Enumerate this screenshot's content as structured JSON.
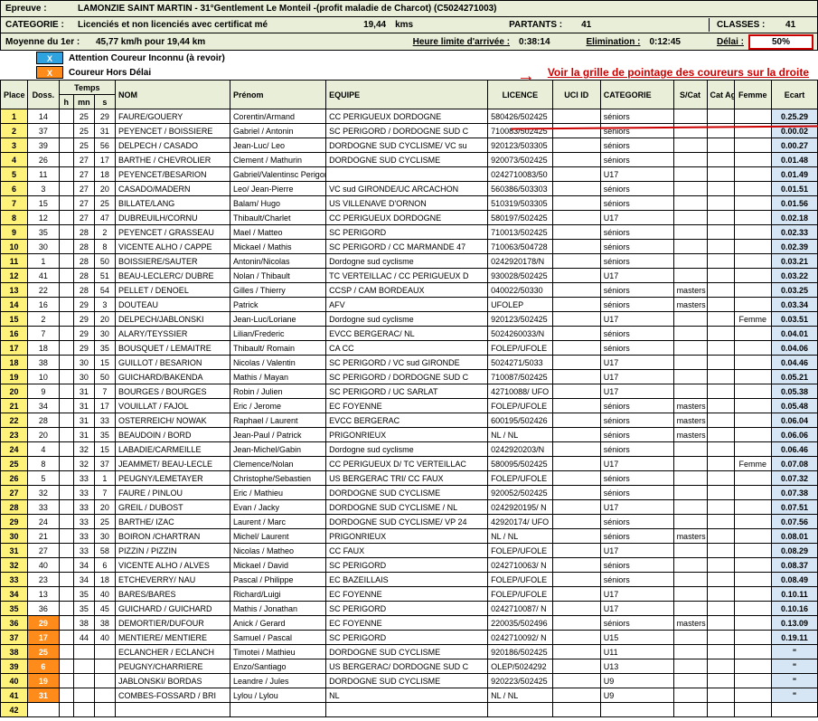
{
  "header": {
    "epreuve_label": "Epreuve :",
    "epreuve_value": "LAMONZIE SAINT MARTIN - 31°Gentlement Le Monteil -(profit maladie de Charcot) (C5024271003)",
    "categorie_label": "CATEGORIE :",
    "categorie_value": "Licenciés et non licenciés avec certificat mé",
    "dist_value": "19,44",
    "dist_unit": "kms",
    "partants_label": "PARTANTS :",
    "partants_value": "41",
    "classes_label": "CLASSES :",
    "classes_value": "41",
    "moyenne_label": "Moyenne du 1er :",
    "moyenne_value": "45,77  km/h   pour 19,44 km",
    "heure_label": "Heure limite d'arrivée :",
    "heure_value": "0:38:14",
    "elim_label": "Elimination :",
    "elim_value": "0:12:45",
    "delai_label": "Délai :",
    "delai_value": "50%"
  },
  "legend": {
    "x": "X",
    "unknown": "Attention Coureur Inconnu (à revoir)",
    "hors": "Coureur Hors Délai",
    "arrow": "→",
    "link": "Voir la grille de pointage des coureurs sur la droite"
  },
  "columns": {
    "place": "Place",
    "doss": "Doss.",
    "temps": "Temps",
    "h": "h",
    "mn": "mn",
    "s": "s",
    "nom": "NOM",
    "prenom": "Prénom",
    "equipe": "EQUIPE",
    "licence": "LICENCE",
    "uci": "UCI ID",
    "categorie": "CATEGORIE",
    "scat": "S/Cat",
    "age": "Cat Age",
    "femme": "Femme",
    "ecart": "Ecart"
  },
  "ditto": "\"",
  "rows": [
    {
      "place": "1",
      "doss": "14",
      "h": "",
      "mn": "25",
      "s": "29",
      "nom": "FAURE/GOUERY",
      "prenom": "Corentin/Armand",
      "equipe": "CC PERIGUEUX DORDOGNE",
      "lic": "580426/502425",
      "uci": "",
      "cat": "séniors",
      "scat": "",
      "age": "",
      "femme": "",
      "ecart": "0.25.29"
    },
    {
      "place": "2",
      "doss": "37",
      "h": "",
      "mn": "25",
      "s": "31",
      "nom": "PEYENCET / BOISSIERE",
      "prenom": "Gabriel / Antonin",
      "equipe": "SC PERIGORD / DORDOGNE SUD C",
      "lic": "710083/502425",
      "uci": "",
      "cat": "séniors",
      "scat": "",
      "age": "",
      "femme": "",
      "ecart": "0.00.02"
    },
    {
      "place": "3",
      "doss": "39",
      "h": "",
      "mn": "25",
      "s": "56",
      "nom": "DELPECH / CASADO",
      "prenom": "Jean-Luc/ Leo",
      "equipe": "DORDOGNE SUD CYCLISME/ VC su",
      "lic": "920123/503305",
      "uci": "",
      "cat": "séniors",
      "scat": "",
      "age": "",
      "femme": "",
      "ecart": "0.00.27"
    },
    {
      "place": "4",
      "doss": "26",
      "h": "",
      "mn": "27",
      "s": "17",
      "nom": "BARTHE / CHEVROLIER",
      "prenom": "Clement / Mathurin",
      "equipe": "DORDOGNE SUD CYCLISME",
      "lic": "920073/502425",
      "uci": "",
      "cat": "séniors",
      "scat": "",
      "age": "",
      "femme": "",
      "ecart": "0.01.48"
    },
    {
      "place": "5",
      "doss": "11",
      "h": "",
      "mn": "27",
      "s": "18",
      "nom": "PEYENCET/BESARION",
      "prenom": "Gabriel/Valentinsc Perigord/Vc Su",
      "equipe": "",
      "lic": "0242710083/50",
      "uci": "",
      "cat": "U17",
      "scat": "",
      "age": "",
      "femme": "",
      "ecart": "0.01.49"
    },
    {
      "place": "6",
      "doss": "3",
      "h": "",
      "mn": "27",
      "s": "20",
      "nom": "CASADO/MADERN",
      "prenom": "Leo/ Jean-Pierre",
      "equipe": "VC sud GIRONDE/UC ARCACHON",
      "lic": "560386/503303",
      "uci": "",
      "cat": "séniors",
      "scat": "",
      "age": "",
      "femme": "",
      "ecart": "0.01.51"
    },
    {
      "place": "7",
      "doss": "15",
      "h": "",
      "mn": "27",
      "s": "25",
      "nom": "BILLATE/LANG",
      "prenom": "Balam/ Hugo",
      "equipe": "US VILLENAVE D'ORNON",
      "lic": "510319/503305",
      "uci": "",
      "cat": "séniors",
      "scat": "",
      "age": "",
      "femme": "",
      "ecart": "0.01.56"
    },
    {
      "place": "8",
      "doss": "12",
      "h": "",
      "mn": "27",
      "s": "47",
      "nom": "DUBREUILH/CORNU",
      "prenom": "Thibault/Charlet",
      "equipe": "CC PERIGUEUX DORDOGNE",
      "lic": "580197/502425",
      "uci": "",
      "cat": "U17",
      "scat": "",
      "age": "",
      "femme": "",
      "ecart": "0.02.18"
    },
    {
      "place": "9",
      "doss": "35",
      "h": "",
      "mn": "28",
      "s": "2",
      "nom": "PEYENCET / GRASSEAU",
      "prenom": "Mael / Matteo",
      "equipe": "SC PERIGORD",
      "lic": "710013/502425",
      "uci": "",
      "cat": "séniors",
      "scat": "",
      "age": "",
      "femme": "",
      "ecart": "0.02.33"
    },
    {
      "place": "10",
      "doss": "30",
      "h": "",
      "mn": "28",
      "s": "8",
      "nom": "VICENTE ALHO / CAPPE",
      "prenom": "Mickael / Mathis",
      "equipe": "SC PERIGORD / CC MARMANDE 47",
      "lic": "710063/504728",
      "uci": "",
      "cat": "séniors",
      "scat": "",
      "age": "",
      "femme": "",
      "ecart": "0.02.39"
    },
    {
      "place": "11",
      "doss": "1",
      "h": "",
      "mn": "28",
      "s": "50",
      "nom": "BOISSIERE/SAUTER",
      "prenom": "Antonin/Nicolas",
      "equipe": "Dordogne sud cyclisme",
      "lic": "0242920178/N",
      "uci": "",
      "cat": "séniors",
      "scat": "",
      "age": "",
      "femme": "",
      "ecart": "0.03.21"
    },
    {
      "place": "12",
      "doss": "41",
      "h": "",
      "mn": "28",
      "s": "51",
      "nom": "BEAU-LECLERC/ DUBRE",
      "prenom": "Nolan / Thibault",
      "equipe": "TC VERTEILLAC / CC PERIGUEUX D",
      "lic": "930028/502425",
      "uci": "",
      "cat": "U17",
      "scat": "",
      "age": "",
      "femme": "",
      "ecart": "0.03.22"
    },
    {
      "place": "13",
      "doss": "22",
      "h": "",
      "mn": "28",
      "s": "54",
      "nom": "PELLET / DENOEL",
      "prenom": "Gilles / Thierry",
      "equipe": "CCSP / CAM BORDEAUX",
      "lic": "040022/50330",
      "uci": "",
      "cat": "séniors",
      "scat": "masters",
      "age": "",
      "femme": "",
      "ecart": "0.03.25"
    },
    {
      "place": "14",
      "doss": "16",
      "h": "",
      "mn": "29",
      "s": "3",
      "nom": "DOUTEAU",
      "prenom": "Patrick",
      "equipe": "AFV",
      "lic": "UFOLEP",
      "uci": "",
      "cat": "séniors",
      "scat": "masters",
      "age": "",
      "femme": "",
      "ecart": "0.03.34"
    },
    {
      "place": "15",
      "doss": "2",
      "h": "",
      "mn": "29",
      "s": "20",
      "nom": "DELPECH/JABLONSKI",
      "prenom": "Jean-Luc/Loriane",
      "equipe": "Dordogne sud cyclisme",
      "lic": "920123/502425",
      "uci": "",
      "cat": "U17",
      "scat": "",
      "age": "",
      "femme": "Femme",
      "ecart": "0.03.51"
    },
    {
      "place": "16",
      "doss": "7",
      "h": "",
      "mn": "29",
      "s": "30",
      "nom": "ALARY/TEYSSIER",
      "prenom": "Lilian/Frederic",
      "equipe": "EVCC BERGERAC/ NL",
      "lic": "5024260033/N",
      "uci": "",
      "cat": "séniors",
      "scat": "",
      "age": "",
      "femme": "",
      "ecart": "0.04.01"
    },
    {
      "place": "17",
      "doss": "18",
      "h": "",
      "mn": "29",
      "s": "35",
      "nom": "BOUSQUET / LEMAITRE",
      "prenom": "Thibault/ Romain",
      "equipe": "CA CC",
      "lic": "FOLEP/UFOLE",
      "uci": "",
      "cat": "séniors",
      "scat": "",
      "age": "",
      "femme": "",
      "ecart": "0.04.06"
    },
    {
      "place": "18",
      "doss": "38",
      "h": "",
      "mn": "30",
      "s": "15",
      "nom": "GUILLOT / BESARION",
      "prenom": "Nicolas / Valentin",
      "equipe": "SC PERIGORD / VC sud GIRONDE",
      "lic": "5024271/5033",
      "uci": "",
      "cat": "U17",
      "scat": "",
      "age": "",
      "femme": "",
      "ecart": "0.04.46"
    },
    {
      "place": "19",
      "doss": "10",
      "h": "",
      "mn": "30",
      "s": "50",
      "nom": "GUICHARD/BAKENDA",
      "prenom": "Mathis / Mayan",
      "equipe": "SC PERIGORD / DORDOGNE SUD C",
      "lic": "710087/502425",
      "uci": "",
      "cat": "U17",
      "scat": "",
      "age": "",
      "femme": "",
      "ecart": "0.05.21"
    },
    {
      "place": "20",
      "doss": "9",
      "h": "",
      "mn": "31",
      "s": "7",
      "nom": "BOURGES / BOURGES",
      "prenom": "Robin / Julien",
      "equipe": "SC PERIGORD / UC SARLAT",
      "lic": "42710088/ UFO",
      "uci": "",
      "cat": "U17",
      "scat": "",
      "age": "",
      "femme": "",
      "ecart": "0.05.38"
    },
    {
      "place": "21",
      "doss": "34",
      "h": "",
      "mn": "31",
      "s": "17",
      "nom": "VOUILLAT / FAJOL",
      "prenom": "Eric / Jerome",
      "equipe": "EC FOYENNE",
      "lic": "FOLEP/UFOLE",
      "uci": "",
      "cat": "séniors",
      "scat": "masters",
      "age": "",
      "femme": "",
      "ecart": "0.05.48"
    },
    {
      "place": "22",
      "doss": "28",
      "h": "",
      "mn": "31",
      "s": "33",
      "nom": "OSTERREICH/ NOWAK",
      "prenom": "Raphael / Laurent",
      "equipe": "EVCC BERGERAC",
      "lic": "600195/502426",
      "uci": "",
      "cat": "séniors",
      "scat": "masters",
      "age": "",
      "femme": "",
      "ecart": "0.06.04"
    },
    {
      "place": "23",
      "doss": "20",
      "h": "",
      "mn": "31",
      "s": "35",
      "nom": "BEAUDOIN / BORD",
      "prenom": "Jean-Paul / Patrick",
      "equipe": "PRIGONRIEUX",
      "lic": "NL / NL",
      "uci": "",
      "cat": "séniors",
      "scat": "masters",
      "age": "",
      "femme": "",
      "ecart": "0.06.06"
    },
    {
      "place": "24",
      "doss": "4",
      "h": "",
      "mn": "32",
      "s": "15",
      "nom": "LABADIE/CARMEILLE",
      "prenom": "Jean-Michel/Gabin",
      "equipe": "Dordogne sud cyclisme",
      "lic": "0242920203/N",
      "uci": "",
      "cat": "séniors",
      "scat": "",
      "age": "",
      "femme": "",
      "ecart": "0.06.46"
    },
    {
      "place": "25",
      "doss": "8",
      "h": "",
      "mn": "32",
      "s": "37",
      "nom": "JEAMMET/ BEAU-LECLE",
      "prenom": "Clemence/Nolan",
      "equipe": "CC PERIGUEUX D/ TC VERTEILLAC",
      "lic": "580095/502425",
      "uci": "",
      "cat": "U17",
      "scat": "",
      "age": "",
      "femme": "Femme",
      "ecart": "0.07.08"
    },
    {
      "place": "26",
      "doss": "5",
      "h": "",
      "mn": "33",
      "s": "1",
      "nom": "PEUGNY/LEMETAYER",
      "prenom": "Christophe/Sebastien",
      "equipe": "US BERGERAC TRI/ CC FAUX",
      "lic": "FOLEP/UFOLE",
      "uci": "",
      "cat": "séniors",
      "scat": "",
      "age": "",
      "femme": "",
      "ecart": "0.07.32"
    },
    {
      "place": "27",
      "doss": "32",
      "h": "",
      "mn": "33",
      "s": "7",
      "nom": "FAURE / PINLOU",
      "prenom": "Eric / Mathieu",
      "equipe": "DORDOGNE SUD CYCLISME",
      "lic": "920052/502425",
      "uci": "",
      "cat": "séniors",
      "scat": "",
      "age": "",
      "femme": "",
      "ecart": "0.07.38"
    },
    {
      "place": "28",
      "doss": "33",
      "h": "",
      "mn": "33",
      "s": "20",
      "nom": "GREIL / DUBOST",
      "prenom": "Evan / Jacky",
      "equipe": "DORDOGNE SUD CYCLISME / NL",
      "lic": "0242920195/ N",
      "uci": "",
      "cat": "U17",
      "scat": "",
      "age": "",
      "femme": "",
      "ecart": "0.07.51"
    },
    {
      "place": "29",
      "doss": "24",
      "h": "",
      "mn": "33",
      "s": "25",
      "nom": "BARTHE/ IZAC",
      "prenom": "Laurent / Marc",
      "equipe": "DORDOGNE SUD CYCLISME/ VP 24",
      "lic": "42920174/ UFO",
      "uci": "",
      "cat": "séniors",
      "scat": "",
      "age": "",
      "femme": "",
      "ecart": "0.07.56"
    },
    {
      "place": "30",
      "doss": "21",
      "h": "",
      "mn": "33",
      "s": "30",
      "nom": "BOIRON /CHARTRAN",
      "prenom": "Michel/ Laurent",
      "equipe": "PRIGONRIEUX",
      "lic": "NL / NL",
      "uci": "",
      "cat": "séniors",
      "scat": "masters",
      "age": "",
      "femme": "",
      "ecart": "0.08.01"
    },
    {
      "place": "31",
      "doss": "27",
      "h": "",
      "mn": "33",
      "s": "58",
      "nom": "PIZZIN / PIZZIN",
      "prenom": "Nicolas / Matheo",
      "equipe": "CC FAUX",
      "lic": "FOLEP/UFOLE",
      "uci": "",
      "cat": "U17",
      "scat": "",
      "age": "",
      "femme": "",
      "ecart": "0.08.29"
    },
    {
      "place": "32",
      "doss": "40",
      "h": "",
      "mn": "34",
      "s": "6",
      "nom": "VICENTE ALHO / ALVES",
      "prenom": "Mickael / David",
      "equipe": "SC PERIGORD",
      "lic": "0242710063/ N",
      "uci": "",
      "cat": "séniors",
      "scat": "",
      "age": "",
      "femme": "",
      "ecart": "0.08.37"
    },
    {
      "place": "33",
      "doss": "23",
      "h": "",
      "mn": "34",
      "s": "18",
      "nom": "ETCHEVERRY/ NAU",
      "prenom": "Pascal / Philippe",
      "equipe": "EC BAZEILLAIS",
      "lic": "FOLEP/UFOLE",
      "uci": "",
      "cat": "séniors",
      "scat": "",
      "age": "",
      "femme": "",
      "ecart": "0.08.49"
    },
    {
      "place": "34",
      "doss": "13",
      "h": "",
      "mn": "35",
      "s": "40",
      "nom": "BARES/BARES",
      "prenom": "Richard/Luigi",
      "equipe": "EC FOYENNE",
      "lic": "FOLEP/UFOLE",
      "uci": "",
      "cat": "U17",
      "scat": "",
      "age": "",
      "femme": "",
      "ecart": "0.10.11"
    },
    {
      "place": "35",
      "doss": "36",
      "h": "",
      "mn": "35",
      "s": "45",
      "nom": "GUICHARD / GUICHARD",
      "prenom": "Mathis / Jonathan",
      "equipe": "SC PERIGORD",
      "lic": "0242710087/ N",
      "uci": "",
      "cat": "U17",
      "scat": "",
      "age": "",
      "femme": "",
      "ecart": "0.10.16"
    },
    {
      "place": "36",
      "doss": "29",
      "doss_orange": true,
      "h": "",
      "mn": "38",
      "s": "38",
      "nom": "DEMORTIER/DUFOUR",
      "prenom": "Anick / Gerard",
      "equipe": "EC FOYENNE",
      "lic": "220035/502496",
      "uci": "",
      "cat": "séniors",
      "scat": "masters",
      "age": "",
      "femme": "",
      "ecart": "0.13.09"
    },
    {
      "place": "37",
      "doss": "17",
      "doss_orange": true,
      "h": "",
      "mn": "44",
      "s": "40",
      "nom": "MENTIERE/ MENTIERE",
      "prenom": "Samuel / Pascal",
      "equipe": "SC PERIGORD",
      "lic": "0242710092/ N",
      "uci": "",
      "cat": "U15",
      "scat": "",
      "age": "",
      "femme": "",
      "ecart": "0.19.11"
    },
    {
      "place": "38",
      "doss": "25",
      "doss_orange": true,
      "h": "",
      "mn": "",
      "s": "",
      "nom": "ECLANCHER / ECLANCH",
      "prenom": "Timotei / Mathieu",
      "equipe": "DORDOGNE SUD CYCLISME",
      "lic": "920186/502425",
      "uci": "",
      "cat": "U11",
      "scat": "",
      "age": "",
      "femme": "",
      "ecart": "\""
    },
    {
      "place": "39",
      "doss": "6",
      "doss_orange": true,
      "h": "",
      "mn": "",
      "s": "",
      "nom": "PEUGNY/CHARRIERE",
      "prenom": "Enzo/Santiago",
      "equipe": "US BERGERAC/ DORDOGNE SUD C",
      "lic": "OLEP/5024292",
      "uci": "",
      "cat": "U13",
      "scat": "",
      "age": "",
      "femme": "",
      "ecart": "\""
    },
    {
      "place": "40",
      "doss": "19",
      "doss_orange": true,
      "h": "",
      "mn": "",
      "s": "",
      "nom": "JABLONSKI/ BORDAS",
      "prenom": "Leandre / Jules",
      "equipe": "DORDOGNE SUD CYCLISME",
      "lic": "920223/502425",
      "uci": "",
      "cat": "U9",
      "scat": "",
      "age": "",
      "femme": "",
      "ecart": "\""
    },
    {
      "place": "41",
      "doss": "31",
      "doss_orange": true,
      "h": "",
      "mn": "",
      "s": "",
      "nom": "COMBES-FOSSARD / BRI",
      "prenom": "Lylou / Lylou",
      "equipe": "NL",
      "lic": "NL / NL",
      "uci": "",
      "cat": "U9",
      "scat": "",
      "age": "",
      "femme": "",
      "ecart": "\""
    },
    {
      "place": "42",
      "doss": "",
      "h": "",
      "mn": "",
      "s": "",
      "nom": "",
      "prenom": "",
      "equipe": "",
      "lic": "",
      "uci": "",
      "cat": "",
      "scat": "",
      "age": "",
      "femme": "",
      "ecart": ""
    }
  ]
}
